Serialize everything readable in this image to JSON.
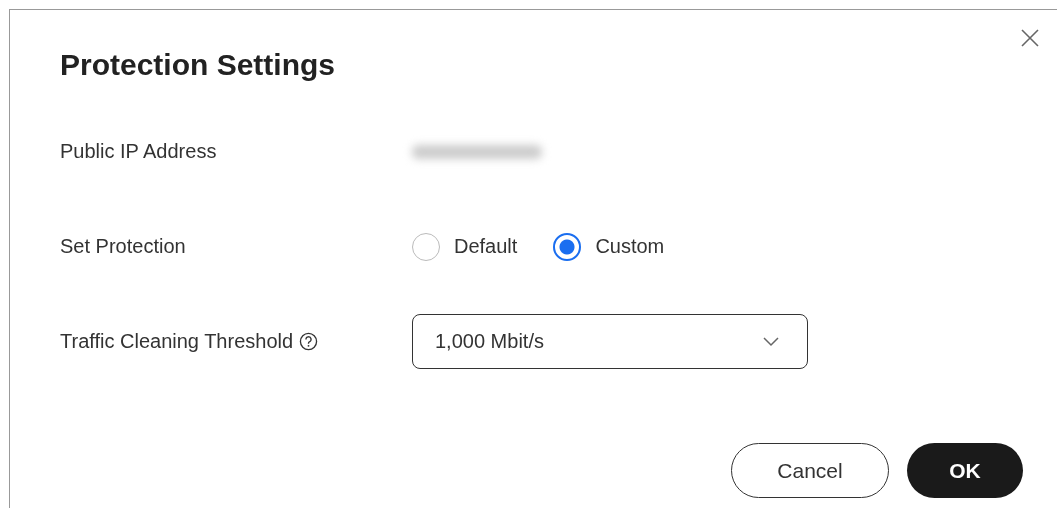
{
  "dialog": {
    "title": "Protection Settings"
  },
  "fields": [
    {
      "kind": "blurred",
      "label": "Public IP Address"
    },
    {
      "kind": "radio",
      "label": "Set Protection",
      "options": [
        {
          "label": "Default",
          "selected": false
        },
        {
          "label": "Custom",
          "selected": true
        }
      ]
    },
    {
      "kind": "select",
      "label": "Traffic Cleaning Threshold",
      "help": true,
      "value": "1,000 Mbit/s"
    }
  ],
  "buttons": [
    {
      "label": "Cancel",
      "kind": "secondary"
    },
    {
      "label": "OK",
      "kind": "primary"
    }
  ]
}
